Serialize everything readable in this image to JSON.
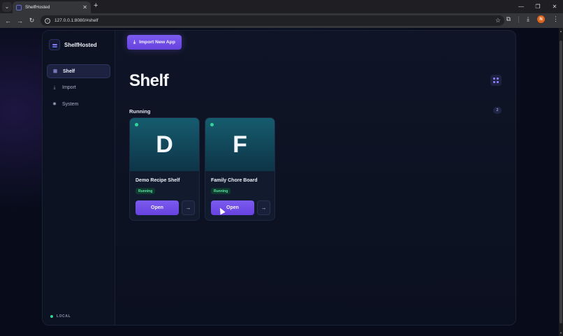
{
  "browser": {
    "tab_title": "ShelfHosted",
    "tab_close": "✕",
    "new_tab": "+",
    "url": "127.0.0.1:8080/#shelf",
    "profile_initial": "N",
    "icons": [
      "back-icon",
      "forward-icon",
      "reload-icon",
      "info-icon",
      "star-icon",
      "extensions-icon",
      "download-icon",
      "menu-icon"
    ]
  },
  "sidebar": {
    "brand": "ShelfHosted",
    "items": [
      {
        "label": "Shelf",
        "icon": "grid-icon",
        "active": true
      },
      {
        "label": "Import",
        "icon": "download-icon",
        "active": false
      },
      {
        "label": "System",
        "icon": "gear-icon",
        "active": false
      }
    ],
    "footer_label": "LOCAL"
  },
  "main": {
    "import_button": "Import New App",
    "title": "Shelf",
    "section_title": "Running",
    "section_count": "2",
    "apps": [
      {
        "letter": "D",
        "name": "Demo Recipe Shelf",
        "status": "Running",
        "open_label": "Open"
      },
      {
        "letter": "F",
        "name": "Family Chore Board",
        "status": "Running",
        "open_label": "Open"
      }
    ]
  },
  "colors": {
    "accent": "#6f4ee8",
    "running": "#34d399",
    "background": "#080c1a"
  }
}
